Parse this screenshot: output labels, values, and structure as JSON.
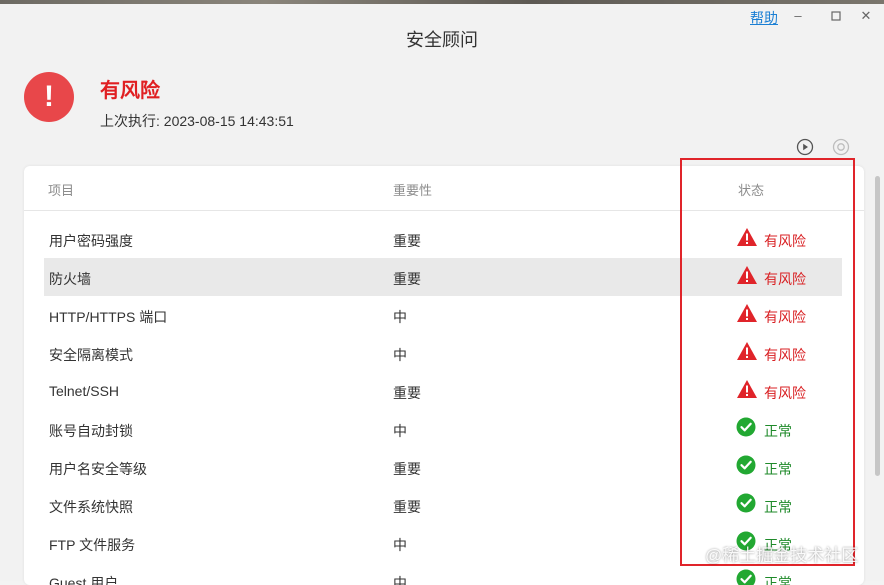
{
  "window": {
    "title": "安全顾问",
    "help_label": "帮助",
    "minimize_glyph": "–",
    "maximize_glyph": "□",
    "close_glyph": "✕"
  },
  "summary": {
    "status_title": "有风险",
    "last_run": "上次执行: 2023-08-15 14:43:51",
    "alert_icon": "exclamation-circle-icon",
    "alert_color": "#e8474a"
  },
  "toolbar": {
    "run_icon": "play-circle-icon",
    "settings_icon": "gear-icon"
  },
  "table": {
    "headers": {
      "item": "项目",
      "importance": "重要性",
      "status": "状态"
    },
    "rows": [
      {
        "item": "用户密码强度",
        "importance": "重要",
        "status": "有风险",
        "state": "risk"
      },
      {
        "item": "防火墙",
        "importance": "重要",
        "status": "有风险",
        "state": "risk"
      },
      {
        "item": "HTTP/HTTPS 端口",
        "importance": "中",
        "status": "有风险",
        "state": "risk"
      },
      {
        "item": "安全隔离模式",
        "importance": "中",
        "status": "有风险",
        "state": "risk"
      },
      {
        "item": "Telnet/SSH",
        "importance": "重要",
        "status": "有风险",
        "state": "risk"
      },
      {
        "item": "账号自动封锁",
        "importance": "中",
        "status": "正常",
        "state": "ok"
      },
      {
        "item": "用户名安全等级",
        "importance": "重要",
        "status": "正常",
        "state": "ok"
      },
      {
        "item": "文件系统快照",
        "importance": "重要",
        "status": "正常",
        "state": "ok"
      },
      {
        "item": "FTP 文件服务",
        "importance": "中",
        "status": "正常",
        "state": "ok"
      },
      {
        "item": "Guest 用户",
        "importance": "中",
        "status": "正常",
        "state": "ok"
      }
    ]
  },
  "colors": {
    "risk": "#d92124",
    "ok": "#1f8a2a",
    "warning_icon": "#e0242a",
    "ok_icon": "#22a832",
    "highlight_row": "#e9e9e9"
  },
  "watermark": "@稀土掘金技术社区"
}
